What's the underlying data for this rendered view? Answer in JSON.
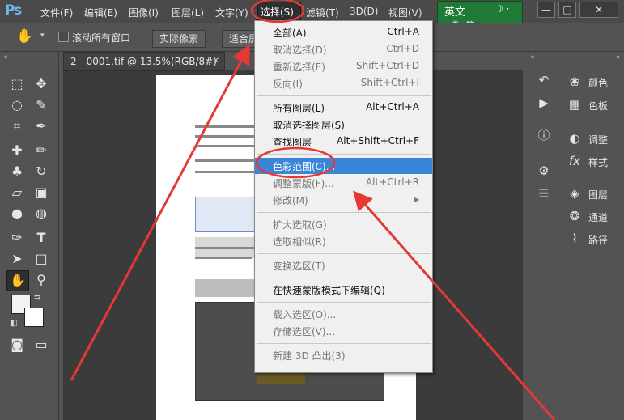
{
  "app": {
    "logo": "Ps",
    "menu": [
      "文件(F)",
      "编辑(E)",
      "图像(I)",
      "图层(L)",
      "文字(Y)",
      "选择(S)",
      "滤镜(T)",
      "3D(D)",
      "视图(V)"
    ],
    "window_buttons": [
      "—",
      "□",
      "✕"
    ]
  },
  "ime": {
    "lang": "英文",
    "row": "☛ 🔍 简 ⊞",
    "moon": "☽ ·"
  },
  "options": {
    "scroll_all_label": "滚动所有窗口",
    "actual_pixels": "实际像素",
    "fit_screen": "适合屏"
  },
  "document": {
    "tab_title": "2 - 0001.tif @ 13.5%(RGB/8#)",
    "tab_close": "✕"
  },
  "select_menu": {
    "groups": [
      [
        {
          "label": "全部(A)",
          "shortcut": "Ctrl+A",
          "disabled": false
        },
        {
          "label": "取消选择(D)",
          "shortcut": "Ctrl+D",
          "disabled": true
        },
        {
          "label": "重新选择(E)",
          "shortcut": "Shift+Ctrl+D",
          "disabled": true
        },
        {
          "label": "反向(I)",
          "shortcut": "Shift+Ctrl+I",
          "disabled": true
        }
      ],
      [
        {
          "label": "所有图层(L)",
          "shortcut": "Alt+Ctrl+A",
          "disabled": false
        },
        {
          "label": "取消选择图层(S)",
          "shortcut": "",
          "disabled": false
        },
        {
          "label": "查找图层",
          "shortcut": "Alt+Shift+Ctrl+F",
          "disabled": false
        }
      ],
      [
        {
          "label": "色彩范围(C)...",
          "shortcut": "",
          "disabled": false,
          "highlight": true
        },
        {
          "label": "调整蒙版(F)...",
          "shortcut": "Alt+Ctrl+R",
          "disabled": true
        },
        {
          "label": "修改(M)",
          "shortcut": "▸",
          "disabled": true
        }
      ],
      [
        {
          "label": "扩大选取(G)",
          "shortcut": "",
          "disabled": true
        },
        {
          "label": "选取相似(R)",
          "shortcut": "",
          "disabled": true
        }
      ],
      [
        {
          "label": "变换选区(T)",
          "shortcut": "",
          "disabled": true
        }
      ],
      [
        {
          "label": "在快速蒙版模式下编辑(Q)",
          "shortcut": "",
          "disabled": false
        }
      ],
      [
        {
          "label": "载入选区(O)...",
          "shortcut": "",
          "disabled": true
        },
        {
          "label": "存储选区(V)...",
          "shortcut": "",
          "disabled": true
        }
      ],
      [
        {
          "label": "新建 3D 凸出(3)",
          "shortcut": "",
          "disabled": true
        }
      ]
    ]
  },
  "panels": [
    {
      "label": "颜色",
      "icon": "palette-icon"
    },
    {
      "label": "色板",
      "icon": "swatches-icon"
    },
    {
      "label": "调整",
      "icon": "adjustments-icon"
    },
    {
      "label": "样式",
      "icon": "styles-icon"
    },
    {
      "label": "图层",
      "icon": "layers-icon"
    },
    {
      "label": "通道",
      "icon": "channels-icon"
    },
    {
      "label": "路径",
      "icon": "paths-icon"
    }
  ],
  "colors": {
    "highlight": "#3a86d6",
    "annotation": "#e53935",
    "ime_bg": "#1e7a34"
  }
}
